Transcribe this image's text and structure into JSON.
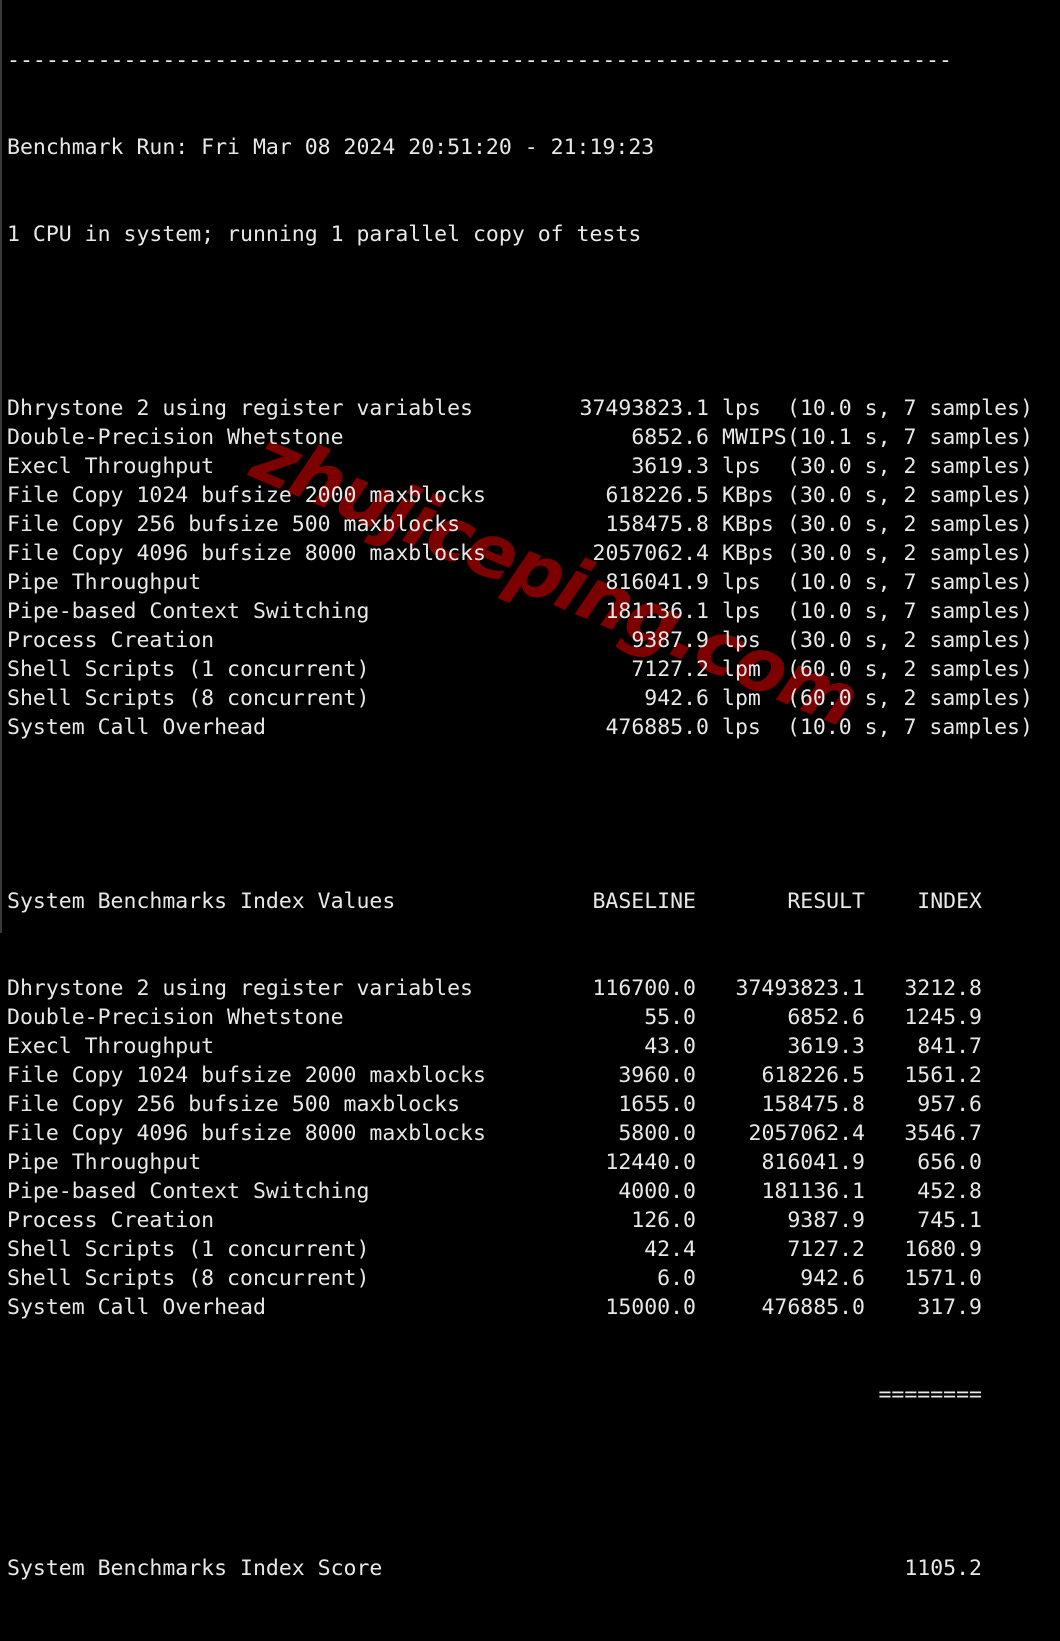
{
  "separator": "-------------------------------------------------------------------------",
  "header": {
    "run_line": "Benchmark Run: Fri Mar 08 2024 20:51:20 - 21:19:23",
    "cpu_line": "1 CPU in system; running 1 parallel copy of tests"
  },
  "results": [
    {
      "name": "Dhrystone 2 using register variables",
      "value": "37493823.1",
      "unit": "lps",
      "meta": "(10.0 s, 7 samples)"
    },
    {
      "name": "Double-Precision Whetstone",
      "value": "6852.6",
      "unit": "MWIPS",
      "meta": "(10.1 s, 7 samples)"
    },
    {
      "name": "Execl Throughput",
      "value": "3619.3",
      "unit": "lps",
      "meta": "(30.0 s, 2 samples)"
    },
    {
      "name": "File Copy 1024 bufsize 2000 maxblocks",
      "value": "618226.5",
      "unit": "KBps",
      "meta": "(30.0 s, 2 samples)"
    },
    {
      "name": "File Copy 256 bufsize 500 maxblocks",
      "value": "158475.8",
      "unit": "KBps",
      "meta": "(30.0 s, 2 samples)"
    },
    {
      "name": "File Copy 4096 bufsize 8000 maxblocks",
      "value": "2057062.4",
      "unit": "KBps",
      "meta": "(30.0 s, 2 samples)"
    },
    {
      "name": "Pipe Throughput",
      "value": "816041.9",
      "unit": "lps",
      "meta": "(10.0 s, 7 samples)"
    },
    {
      "name": "Pipe-based Context Switching",
      "value": "181136.1",
      "unit": "lps",
      "meta": "(10.0 s, 7 samples)"
    },
    {
      "name": "Process Creation",
      "value": "9387.9",
      "unit": "lps",
      "meta": "(30.0 s, 2 samples)"
    },
    {
      "name": "Shell Scripts (1 concurrent)",
      "value": "7127.2",
      "unit": "lpm",
      "meta": "(60.0 s, 2 samples)"
    },
    {
      "name": "Shell Scripts (8 concurrent)",
      "value": "942.6",
      "unit": "lpm",
      "meta": "(60.0 s, 2 samples)"
    },
    {
      "name": "System Call Overhead",
      "value": "476885.0",
      "unit": "lps",
      "meta": "(10.0 s, 7 samples)"
    }
  ],
  "index": {
    "title": "System Benchmarks Index Values",
    "columns": [
      "BASELINE",
      "RESULT",
      "INDEX"
    ],
    "rows": [
      {
        "name": "Dhrystone 2 using register variables",
        "baseline": "116700.0",
        "result": "37493823.1",
        "index": "3212.8"
      },
      {
        "name": "Double-Precision Whetstone",
        "baseline": "55.0",
        "result": "6852.6",
        "index": "1245.9"
      },
      {
        "name": "Execl Throughput",
        "baseline": "43.0",
        "result": "3619.3",
        "index": "841.7"
      },
      {
        "name": "File Copy 1024 bufsize 2000 maxblocks",
        "baseline": "3960.0",
        "result": "618226.5",
        "index": "1561.2"
      },
      {
        "name": "File Copy 256 bufsize 500 maxblocks",
        "baseline": "1655.0",
        "result": "158475.8",
        "index": "957.6"
      },
      {
        "name": "File Copy 4096 bufsize 8000 maxblocks",
        "baseline": "5800.0",
        "result": "2057062.4",
        "index": "3546.7"
      },
      {
        "name": "Pipe Throughput",
        "baseline": "12440.0",
        "result": "816041.9",
        "index": "656.0"
      },
      {
        "name": "Pipe-based Context Switching",
        "baseline": "4000.0",
        "result": "181136.1",
        "index": "452.8"
      },
      {
        "name": "Process Creation",
        "baseline": "126.0",
        "result": "9387.9",
        "index": "745.1"
      },
      {
        "name": "Shell Scripts (1 concurrent)",
        "baseline": "42.4",
        "result": "7127.2",
        "index": "1680.9"
      },
      {
        "name": "Shell Scripts (8 concurrent)",
        "baseline": "6.0",
        "result": "942.6",
        "index": "1571.0"
      },
      {
        "name": "System Call Overhead",
        "baseline": "15000.0",
        "result": "476885.0",
        "index": "317.9"
      }
    ],
    "rule": "========",
    "score_label": "System Benchmarks Index Score",
    "score": "1105.2"
  },
  "watermark": "zhujiceping.com",
  "colors": {
    "background": "#000000",
    "text": "#e8e8e8",
    "watermark": "#7d0000"
  }
}
